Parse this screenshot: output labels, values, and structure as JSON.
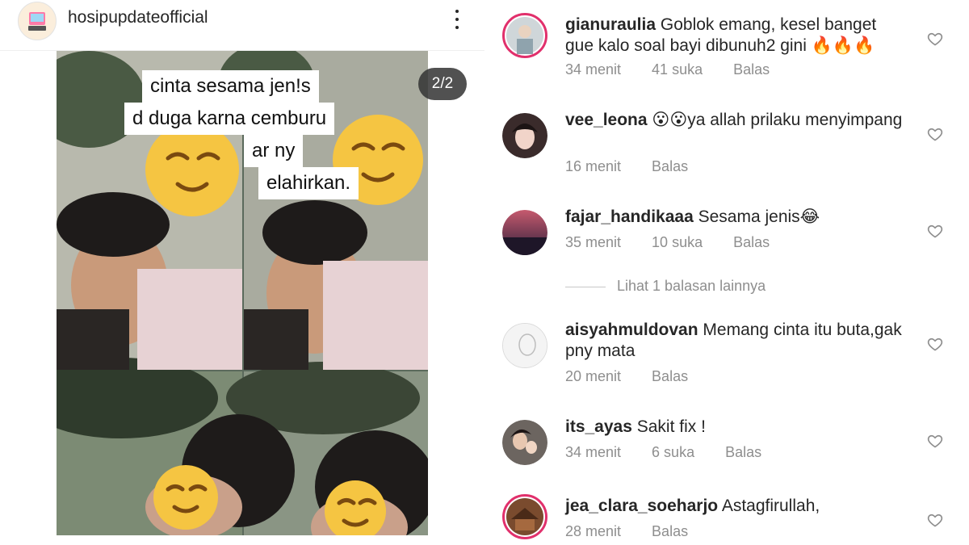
{
  "post": {
    "username": "hosipupdateofficial",
    "slide_counter": "2/2",
    "image_caption_lines": [
      "cinta sesama jen!s",
      "d duga karna cemburu",
      "ar ny",
      "elahirkan."
    ]
  },
  "comments": [
    {
      "user": "gianuraulia",
      "text": "Goblok emang, kesel banget gue kalo soal bayi dibunuh2 gini 🔥🔥🔥",
      "time": "34 menit",
      "likes": "41 suka",
      "reply": "Balas"
    },
    {
      "user": "vee_leona",
      "text": "😮😮ya allah prilaku menyimpang",
      "time": "16 menit",
      "likes": "",
      "reply": "Balas"
    },
    {
      "user": "fajar_handikaaa",
      "text": "Sesama jenis😂",
      "time": "35 menit",
      "likes": "10 suka",
      "reply": "Balas"
    },
    {
      "user": "aisyahmuldovan",
      "text": "Memang cinta itu buta,gak pny mata",
      "time": "20 menit",
      "likes": "",
      "reply": "Balas"
    },
    {
      "user": "its_ayas",
      "text": "Sakit fix !",
      "time": "34 menit",
      "likes": "6 suka",
      "reply": "Balas"
    },
    {
      "user": "jea_clara_soeharjo",
      "text": "Astagfirullah,",
      "time": "28 menit",
      "likes": "",
      "reply": "Balas"
    }
  ],
  "more_replies": "Lihat 1 balasan lainnya"
}
